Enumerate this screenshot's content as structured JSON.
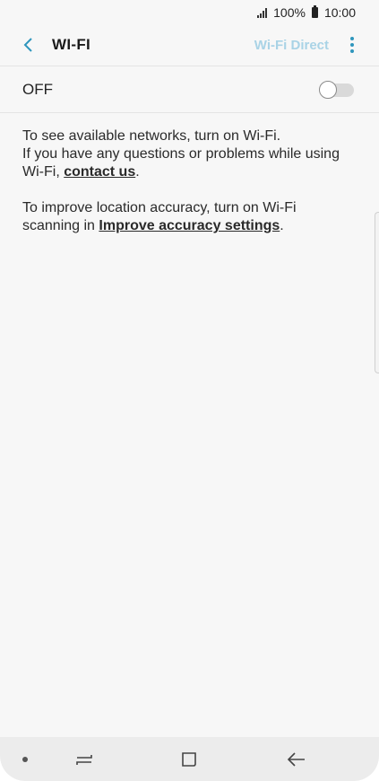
{
  "status_bar": {
    "battery": "100%",
    "time": "10:00"
  },
  "header": {
    "title": "WI-FI",
    "wifi_direct_label": "Wi-Fi Direct",
    "back_icon": "chevron-left-icon",
    "more_icon": "more-vertical-icon"
  },
  "switch": {
    "label": "OFF",
    "state": false
  },
  "description": {
    "p1_line1": "To see available networks, turn on Wi-Fi.",
    "p1_line2_prefix": "If you have any questions or problems while using Wi-Fi, ",
    "contact_link": "contact us",
    "p1_suffix": ".",
    "p2_prefix": "To improve location accuracy, turn on Wi-Fi scanning in ",
    "accuracy_link": "Improve accuracy settings",
    "p2_suffix": "."
  },
  "colors": {
    "accent": "#2f96bd",
    "wifi_direct_disabled": "#a9d3e6",
    "background": "#f7f7f7"
  }
}
